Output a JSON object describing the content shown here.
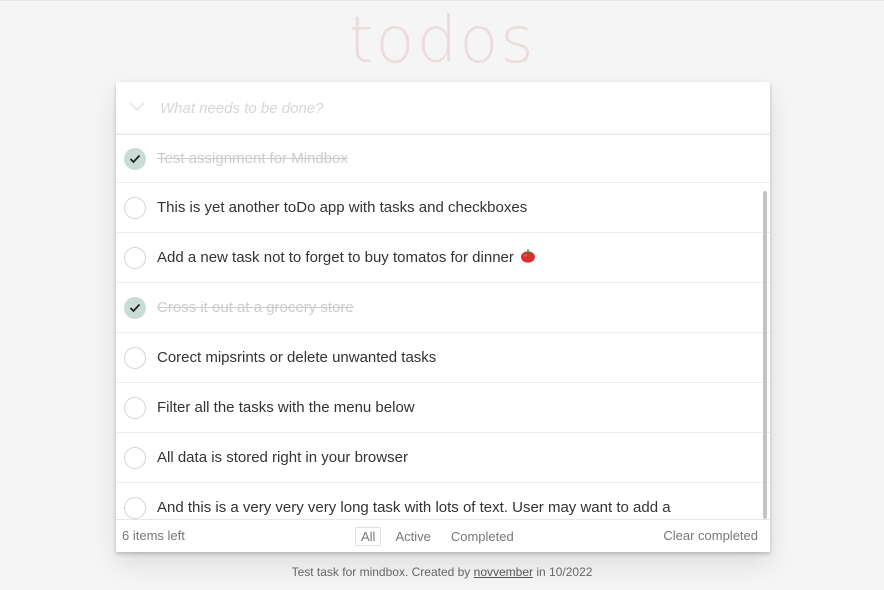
{
  "header": {
    "title": "todos"
  },
  "new_todo": {
    "placeholder": "What needs to be done?",
    "value": "",
    "toggle_icon": "chevron-down-icon"
  },
  "todos": [
    {
      "text": "Test assignment for Mindbox",
      "completed": true
    },
    {
      "text": "This is yet another toDo app with tasks and checkboxes",
      "completed": false
    },
    {
      "text": "Add a new task not to forget to buy tomatos for dinner",
      "completed": false,
      "icon": "tomato-icon"
    },
    {
      "text": "Cross it out at a grocery store",
      "completed": true
    },
    {
      "text": "Corect mipsrints or delete unwanted tasks",
      "completed": false
    },
    {
      "text": "Filter all the tasks with the menu below",
      "completed": false
    },
    {
      "text": "All data is stored right in your browser",
      "completed": false
    },
    {
      "text": "And this is a very very very long task with lots of text. User may want to add a",
      "completed": false
    }
  ],
  "footer": {
    "items_left": "6 items left",
    "filters": [
      "All",
      "Active",
      "Completed"
    ],
    "selected_filter": "All",
    "clear_completed": "Clear completed"
  },
  "info": {
    "prefix": "Test task for mindbox. Created by ",
    "author": "novvember",
    "suffix": " in 10/2022"
  },
  "colors": {
    "title": "#ead7d7",
    "checked_fill": "#c9dcd5",
    "completed_text": "#cccccc",
    "background": "#f5f5f5"
  }
}
